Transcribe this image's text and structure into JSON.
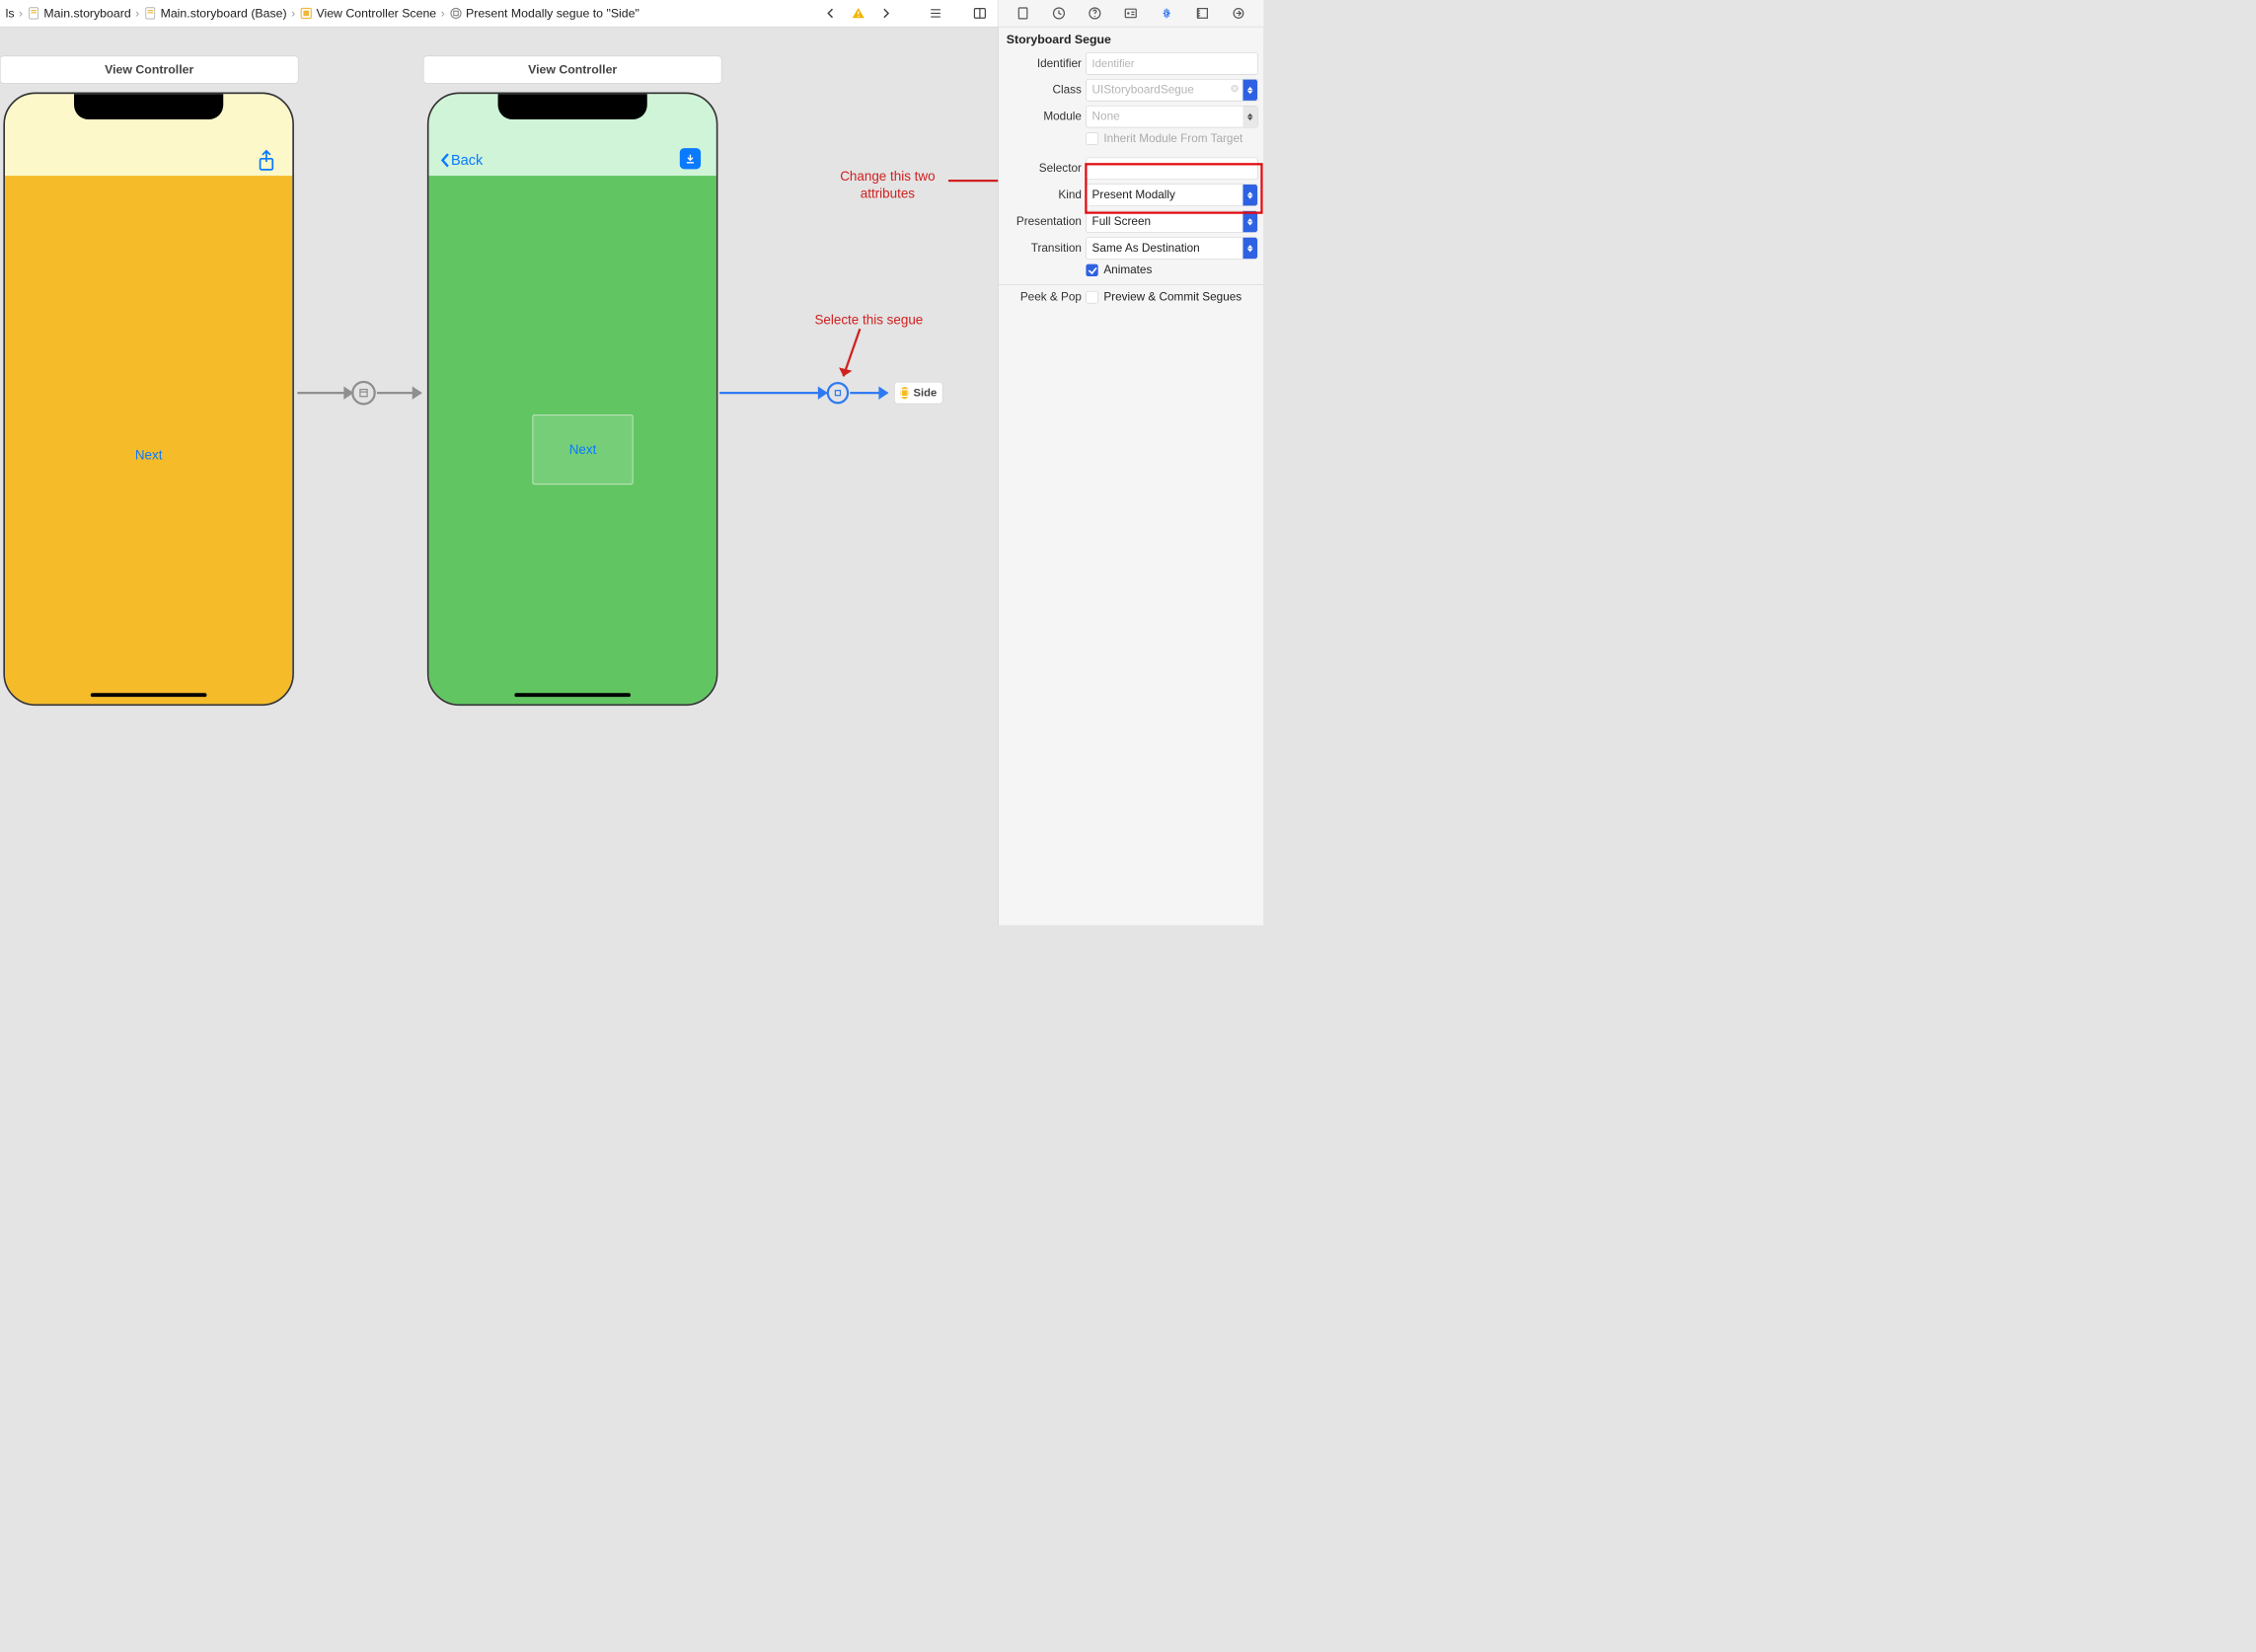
{
  "breadcrumbs": {
    "item0": "ls",
    "item1": "Main.storyboard",
    "item2": "Main.storyboard (Base)",
    "item3": "View Controller Scene",
    "item4": "Present Modally segue to \"Side\""
  },
  "canvas": {
    "vc1_title": "View Controller",
    "vc2_title": "View Controller",
    "vc1_button": "Next",
    "vc2_back": "Back",
    "vc2_button": "Next",
    "side_ref": "Side"
  },
  "annotations": {
    "select_segue": "Selecte this segue",
    "change_attrs_line1": "Change this two",
    "change_attrs_line2": "attributes"
  },
  "inspector": {
    "section_title": "Storyboard Segue",
    "identifier_label": "Identifier",
    "identifier_placeholder": "Identifier",
    "class_label": "Class",
    "class_value": "UIStoryboardSegue",
    "module_label": "Module",
    "module_value": "None",
    "inherit_label": "Inherit Module From Target",
    "selector_label": "Selector",
    "kind_label": "Kind",
    "kind_value": "Present Modally",
    "presentation_label": "Presentation",
    "presentation_value": "Full Screen",
    "transition_label": "Transition",
    "transition_value": "Same As Destination",
    "animates_label": "Animates",
    "peek_pop_label": "Peek & Pop",
    "peek_pop_option": "Preview & Commit Segues"
  }
}
